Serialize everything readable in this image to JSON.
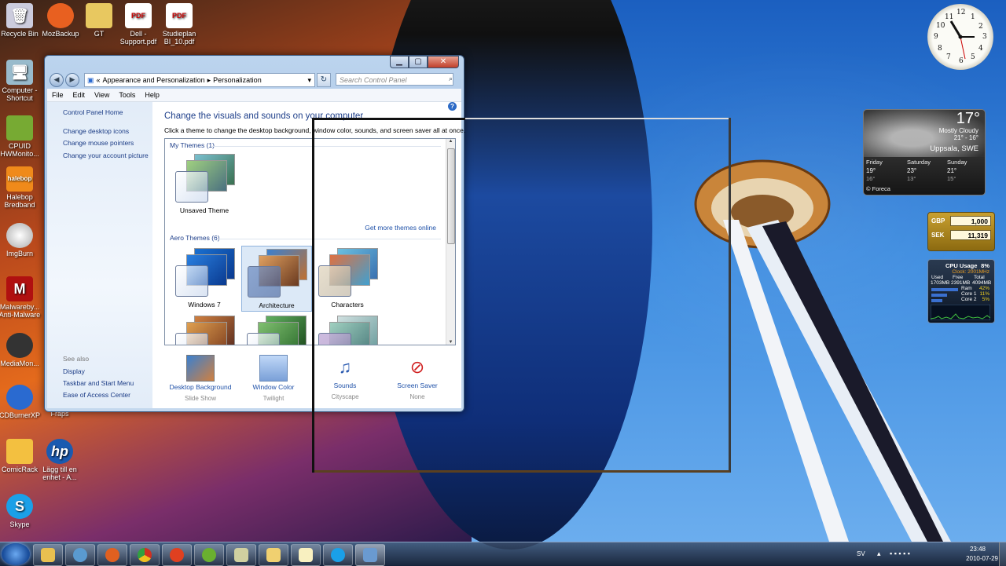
{
  "desktop_icons": [
    {
      "label": "Recycle Bin",
      "icon": "recycle-bin-icon"
    },
    {
      "label": "MozBackup",
      "icon": "mozbackup-icon"
    },
    {
      "label": "GT",
      "icon": "gt-icon"
    },
    {
      "label": "Dell - Support.pdf",
      "icon": "pdf-icon"
    },
    {
      "label": "Studieplan BI_10.pdf",
      "icon": "pdf-icon"
    },
    {
      "label": "Computer - Shortcut",
      "icon": "computer-icon"
    },
    {
      "label": "CPUID HWMonito...",
      "icon": "cpuid-icon"
    },
    {
      "label": "Halebop Bredband",
      "icon": "halebop-icon"
    },
    {
      "label": "ImgBurn",
      "icon": "imgburn-icon"
    },
    {
      "label": "Malwareby... Anti-Malware",
      "icon": "malwarebytes-icon"
    },
    {
      "label": "MediaMon...",
      "icon": "mediamonkey-icon"
    },
    {
      "label": "CDBurnerXP",
      "icon": "cdburnerxp-icon"
    },
    {
      "label": "Fraps",
      "icon": "fraps-icon"
    },
    {
      "label": "ComicRack",
      "icon": "comicrack-icon"
    },
    {
      "label": "Lägg till en enhet - A...",
      "icon": "hp-icon"
    },
    {
      "label": "Skype",
      "icon": "skype-icon"
    }
  ],
  "window": {
    "address": {
      "chevron": "«",
      "crumb1": "Appearance and Personalization",
      "separator": "▸",
      "crumb2": "Personalization"
    },
    "search_placeholder": "Search Control Panel",
    "menu": [
      "File",
      "Edit",
      "View",
      "Tools",
      "Help"
    ],
    "left_pane": {
      "home": "Control Panel Home",
      "links": [
        "Change desktop icons",
        "Change mouse pointers",
        "Change your account picture"
      ],
      "see_also_heading": "See also",
      "see_also": [
        "Display",
        "Taskbar and Start Menu",
        "Ease of Access Center"
      ]
    },
    "main": {
      "title": "Change the visuals and sounds on your computer",
      "subtitle": "Click a theme to change the desktop background, window color, sounds, and screen saver all at once.",
      "my_themes_heading": "My Themes (1)",
      "unsaved_theme": "Unsaved Theme",
      "get_more": "Get more themes online",
      "aero_heading": "Aero Themes (6)",
      "aero_themes": [
        "Windows 7",
        "Architecture",
        "Characters"
      ],
      "selected_theme": "Architecture"
    },
    "bottom": [
      {
        "link": "Desktop Background",
        "sub": "Slide Show",
        "icon": "desktop-background-icon"
      },
      {
        "link": "Window Color",
        "sub": "Twilight",
        "icon": "window-color-icon"
      },
      {
        "link": "Sounds",
        "sub": "Cityscape",
        "icon": "sounds-icon"
      },
      {
        "link": "Screen Saver",
        "sub": "None",
        "icon": "screen-saver-icon"
      }
    ]
  },
  "gadgets": {
    "clock": {
      "numbers": [
        "12",
        "1",
        "2",
        "3",
        "4",
        "5",
        "6",
        "7",
        "8",
        "9",
        "10",
        "11"
      ]
    },
    "weather": {
      "temp": "17°",
      "condition": "Mostly Cloudy",
      "range": "21° - 16°",
      "location": "Uppsala, SWE",
      "credit": "© Foreca",
      "days": [
        {
          "day": "Friday",
          "high": "19°",
          "low": "16°"
        },
        {
          "day": "Saturday",
          "high": "23°",
          "low": "13°"
        },
        {
          "day": "Sunday",
          "high": "21°",
          "low": "15°"
        }
      ]
    },
    "currency": [
      {
        "code": "GBP",
        "value": "1,000"
      },
      {
        "code": "SEK",
        "value": "11,319"
      }
    ],
    "cpu": {
      "title": "CPU Usage",
      "percent": "8%",
      "clock": "Clock: 2001MHz",
      "used_label": "Used",
      "free_label": "Free",
      "total_label": "Total",
      "used": "1703MB",
      "free": "2391MB",
      "total": "4094MB",
      "ram_label": "Ram",
      "ram": "42%",
      "core1_label": "Core 1",
      "core1": "11%",
      "core2_label": "Core 2",
      "core2": "5%"
    }
  },
  "taskbar": {
    "apps": [
      "explorer-icon",
      "network-icon",
      "firefox-icon",
      "chrome-icon",
      "bullet-icon",
      "spotify-icon",
      "app-icon",
      "folder-icon",
      "notepad-icon",
      "skype-icon",
      "control-panel-icon"
    ],
    "language": "SV",
    "time": "23:48",
    "date": "2010-07-29"
  }
}
